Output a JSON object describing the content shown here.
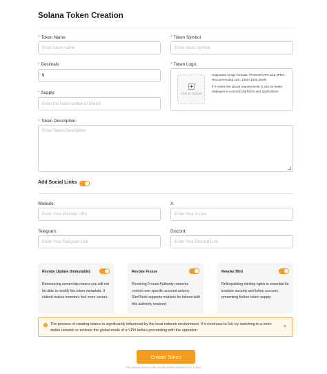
{
  "page": {
    "title": "Solana Token Creation"
  },
  "form": {
    "token_name": {
      "label": "Token Name",
      "placeholder": "Enter token name",
      "required": true
    },
    "token_symbol": {
      "label": "Token Symbol",
      "placeholder": "Enter token symbol",
      "required": true
    },
    "decimals": {
      "label": "Decimals",
      "value": "9",
      "required": true
    },
    "token_logo": {
      "label": "Token Logo:",
      "upload_label": "Click to Upload",
      "formats": "Supported image formats: PNG/GIF/JPG and JPEG",
      "recommended": "Recommended size: 1000×1000 pixels",
      "note": "If it meets the above requirements, it can be better displayed on various platforms and applications."
    },
    "supply": {
      "label": "Supply:",
      "placeholder": "Enter the total number of tokens",
      "required": true
    },
    "description": {
      "label": "Token Description:",
      "placeholder": "Enter Token Description",
      "required": true
    }
  },
  "social": {
    "heading": "Add Social Links",
    "enabled": true,
    "website": {
      "label": "Website:",
      "placeholder": "Enter Your Website URL"
    },
    "x": {
      "label": "X:",
      "placeholder": "Enter Your X Link"
    },
    "telegram": {
      "label": "Telegram:",
      "placeholder": "Enter Your Telegram Link"
    },
    "discord": {
      "label": "Discord:",
      "placeholder": "Enter Your Discord Link"
    }
  },
  "authorities": [
    {
      "title": "Revoke Update (Immutable)",
      "enabled": true,
      "description": "Renouncing ownership means you will not be able to modify the token metadata. It indeed makes investors feel more secure."
    },
    {
      "title": "Revoke Freeze",
      "enabled": true,
      "description": "Revoking Freeze Authority removes control over specific account actions. SlerfTools supports markets for tokens with this authority retained."
    },
    {
      "title": "Revoke Mint",
      "enabled": true,
      "description": "Relinquishing minting rights is essential for investor security and token success, preventing further token supply."
    }
  ],
  "alert": {
    "icon": "warning-icon",
    "text": "The process of creating tokens is significantly influenced by the local network environment. If it continues to fail, try switching to a more stable network or activate the global mode of a VPN before proceeding with the operation.",
    "close": "×"
  },
  "actions": {
    "create_label": "Create Token",
    "fee_note": "The lowest service fee on the entire network is 0.1 SOL"
  },
  "colors": {
    "accent": "#f39c1f",
    "required": "#f05050",
    "alert_border": "#f4b260",
    "alert_bg": "#fff7ea"
  }
}
